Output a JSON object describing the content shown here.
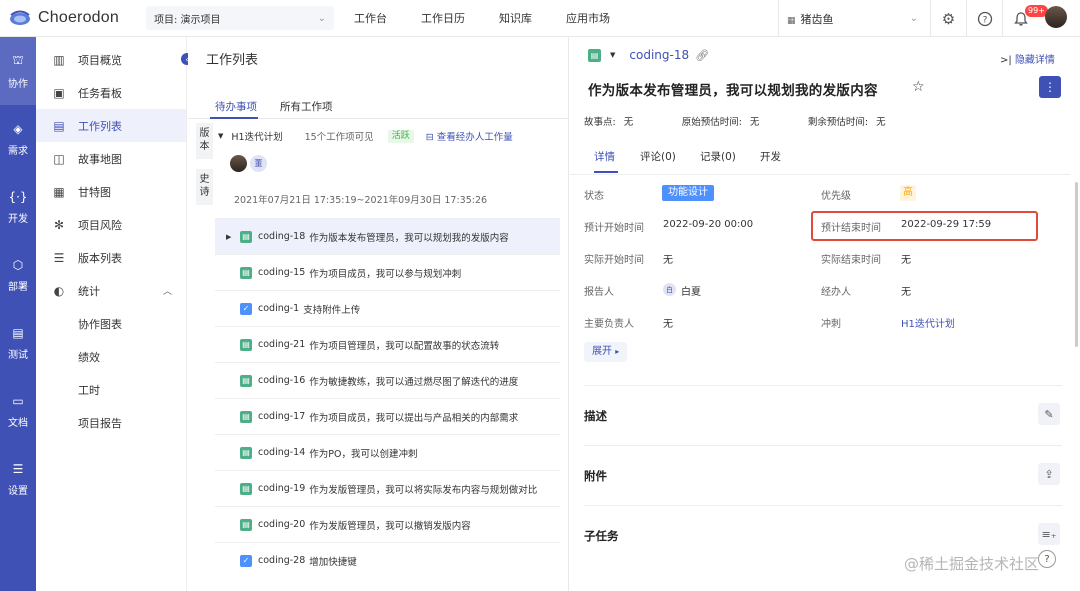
{
  "topbar": {
    "logo_text": "Choerodon",
    "project_select": "项目: 演示项目",
    "nav": [
      "工作台",
      "工作日历",
      "知识库",
      "应用市场"
    ],
    "org_select": "猪齿鱼",
    "notification_badge": "99+"
  },
  "rail": [
    {
      "label": "协作",
      "icon": "hands-icon"
    },
    {
      "label": "需求",
      "icon": "layers-icon"
    },
    {
      "label": "开发",
      "icon": "code-icon"
    },
    {
      "label": "部署",
      "icon": "deploy-icon"
    },
    {
      "label": "测试",
      "icon": "clipboard-icon"
    },
    {
      "label": "文档",
      "icon": "inbox-icon"
    },
    {
      "label": "设置",
      "icon": "server-icon"
    }
  ],
  "sidebar": {
    "items": [
      {
        "label": "项目概览",
        "icon": "overview-icon"
      },
      {
        "label": "任务看板",
        "icon": "board-icon"
      },
      {
        "label": "工作列表",
        "icon": "list-icon"
      },
      {
        "label": "故事地图",
        "icon": "map-icon"
      },
      {
        "label": "甘特图",
        "icon": "gantt-icon"
      },
      {
        "label": "项目风险",
        "icon": "risk-icon"
      },
      {
        "label": "版本列表",
        "icon": "version-icon"
      },
      {
        "label": "统计",
        "icon": "stats-icon"
      }
    ],
    "sub_items": [
      "协作图表",
      "绩效",
      "工时",
      "项目报告"
    ]
  },
  "worklist": {
    "title": "工作列表",
    "tabs": [
      "待办事项",
      "所有工作项"
    ],
    "vtabs": [
      "版本",
      "史诗"
    ],
    "sprint": {
      "name": "H1迭代计划",
      "count": "15个工作项可见",
      "status": "活跃",
      "link": "查看经办人工作量",
      "member_initial": "董",
      "dates": "2021年07月21日 17:35:19~2021年09月30日 17:35:26"
    },
    "issues": [
      {
        "key": "coding-18",
        "summary": "作为版本发布管理员，我可以规划我的发版内容",
        "type": "story"
      },
      {
        "key": "coding-15",
        "summary": "作为项目成员，我可以参与规划冲刺",
        "type": "story"
      },
      {
        "key": "coding-1",
        "summary": "支持附件上传",
        "type": "task"
      },
      {
        "key": "coding-21",
        "summary": "作为项目管理员，我可以配置故事的状态流转",
        "type": "story"
      },
      {
        "key": "coding-16",
        "summary": "作为敏捷教练，我可以通过燃尽图了解迭代的进度",
        "type": "story"
      },
      {
        "key": "coding-17",
        "summary": "作为项目成员，我可以提出与产品相关的内部需求",
        "type": "story"
      },
      {
        "key": "coding-14",
        "summary": "作为PO，我可以创建冲刺",
        "type": "story"
      },
      {
        "key": "coding-19",
        "summary": "作为发版管理员，我可以将实际发布内容与规划做对比",
        "type": "story"
      },
      {
        "key": "coding-20",
        "summary": "作为发版管理员，我可以撤销发版内容",
        "type": "story"
      },
      {
        "key": "coding-28",
        "summary": "增加快捷键",
        "type": "task"
      }
    ]
  },
  "detail": {
    "key": "coding-18",
    "hide_label": "隐藏详情",
    "title": "作为版本发布管理员，我可以规划我的发版内容",
    "story_points_label": "故事点:",
    "story_points": "无",
    "orig_est_label": "原始预估时间:",
    "orig_est": "无",
    "remain_est_label": "剩余预估时间:",
    "remain_est": "无",
    "tabs": [
      "详情",
      "评论(0)",
      "记录(0)",
      "开发"
    ],
    "fields": {
      "status_label": "状态",
      "status": "功能设计",
      "priority_label": "优先级",
      "priority": "高",
      "plan_start_label": "预计开始时间",
      "plan_start": "2022-09-20 00:00",
      "plan_end_label": "预计结束时间",
      "plan_end": "2022-09-29 17:59",
      "actual_start_label": "实际开始时间",
      "actual_start": "无",
      "actual_end_label": "实际结束时间",
      "actual_end": "无",
      "reporter_label": "报告人",
      "reporter": "白夏",
      "reporter_initial": "白",
      "assignee_label": "经办人",
      "assignee": "无",
      "owner_label": "主要负责人",
      "owner": "无",
      "sprint_label": "冲刺",
      "sprint": "H1迭代计划"
    },
    "expand": "展开",
    "sections": [
      "描述",
      "附件",
      "子任务"
    ]
  },
  "watermark": "@稀土掘金技术社区",
  "colors": {
    "primary": "#3f51b5",
    "highlight_border": "#e04a3b",
    "story": "#4caf88",
    "task": "#4d90fe"
  }
}
